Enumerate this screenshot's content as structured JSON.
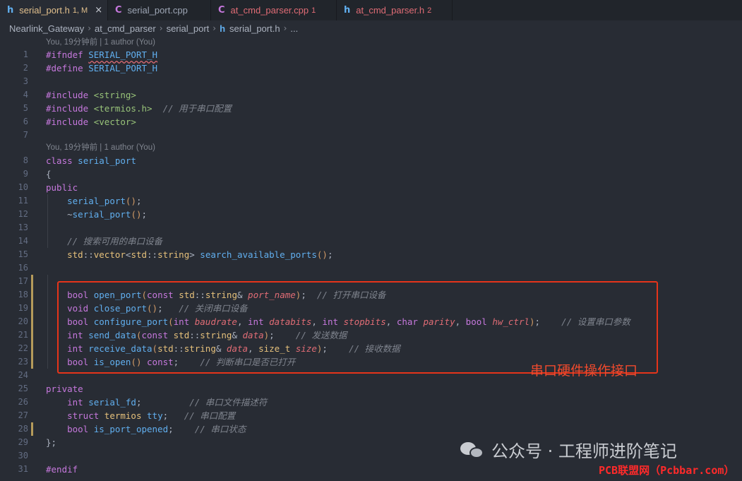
{
  "tabs": [
    {
      "icon": "h",
      "name": "serial_port.h",
      "badge": "1, M",
      "close": "×",
      "state": "active"
    },
    {
      "icon": "C",
      "name": "serial_port.cpp",
      "badge": "",
      "close": "",
      "state": "normal"
    },
    {
      "icon": "C",
      "name": "at_cmd_parser.cpp",
      "badge": "1",
      "close": "",
      "state": "error"
    },
    {
      "icon": "h",
      "name": "at_cmd_parser.h",
      "badge": "2",
      "close": "",
      "state": "error"
    }
  ],
  "breadcrumb": {
    "items": [
      "Nearlink_Gateway",
      "at_cmd_parser",
      "serial_port"
    ],
    "file_icon": "h",
    "file": "serial_port.h",
    "more": "...",
    "sep": "›"
  },
  "codelens": [
    {
      "before_line": 1,
      "text": "You, 19分钟前 | 1 author (You)"
    },
    {
      "before_line": 8,
      "text": "You, 19分钟前 | 1 author (You)"
    }
  ],
  "lines": [
    {
      "n": "1",
      "code": "#ifndef SERIAL_PORT_H"
    },
    {
      "n": "2",
      "code": "#define SERIAL_PORT_H"
    },
    {
      "n": "3",
      "code": ""
    },
    {
      "n": "4",
      "code": "#include <string>"
    },
    {
      "n": "5",
      "code": "#include <termios.h>  // 用于串口配置"
    },
    {
      "n": "6",
      "code": "#include <vector>"
    },
    {
      "n": "7",
      "code": ""
    },
    {
      "n": "8",
      "code": "class serial_port"
    },
    {
      "n": "9",
      "code": "{"
    },
    {
      "n": "10",
      "code": "public:"
    },
    {
      "n": "11",
      "code": "    serial_port();"
    },
    {
      "n": "12",
      "code": "    ~serial_port();"
    },
    {
      "n": "13",
      "code": ""
    },
    {
      "n": "14",
      "code": "    // 搜索可用的串口设备"
    },
    {
      "n": "15",
      "code": "    std::vector<std::string> search_available_ports();"
    },
    {
      "n": "16",
      "code": ""
    },
    {
      "n": "17",
      "code": ""
    },
    {
      "n": "18",
      "code": "    bool open_port(const std::string& port_name);  // 打开串口设备"
    },
    {
      "n": "19",
      "code": "    void close_port();   // 关闭串口设备"
    },
    {
      "n": "20",
      "code": "    bool configure_port(int baudrate, int databits, int stopbits, char parity, bool hw_ctrl);    // 设置串口参数"
    },
    {
      "n": "21",
      "code": "    int send_data(const std::string& data);    // 发送数据"
    },
    {
      "n": "22",
      "code": "    int receive_data(std::string& data, size_t size);    // 接收数据"
    },
    {
      "n": "23",
      "code": "    bool is_open() const;    // 判断串口是否已打开"
    },
    {
      "n": "24",
      "code": ""
    },
    {
      "n": "25",
      "code": "private:"
    },
    {
      "n": "26",
      "code": "    int serial_fd;         // 串口文件描述符"
    },
    {
      "n": "27",
      "code": "    struct termios tty;   // 串口配置"
    },
    {
      "n": "28",
      "code": "    bool is_port_opened;    // 串口状态"
    },
    {
      "n": "29",
      "code": "};"
    },
    {
      "n": "30",
      "code": ""
    },
    {
      "n": "31",
      "code": "#endif"
    }
  ],
  "annotation": "串口硬件操作接口",
  "watermark": {
    "icon": "wechat-icon",
    "text": "公众号 · 工程师进阶笔记",
    "site": "PCB联盟网（Pcbbar.com）"
  },
  "colors": {
    "keyword": "#c678dd",
    "function": "#61afef",
    "type": "#e5c07b",
    "string": "#98c379",
    "comment": "#7f848e",
    "param": "#e06c75",
    "highlight_box": "#e5341a"
  }
}
